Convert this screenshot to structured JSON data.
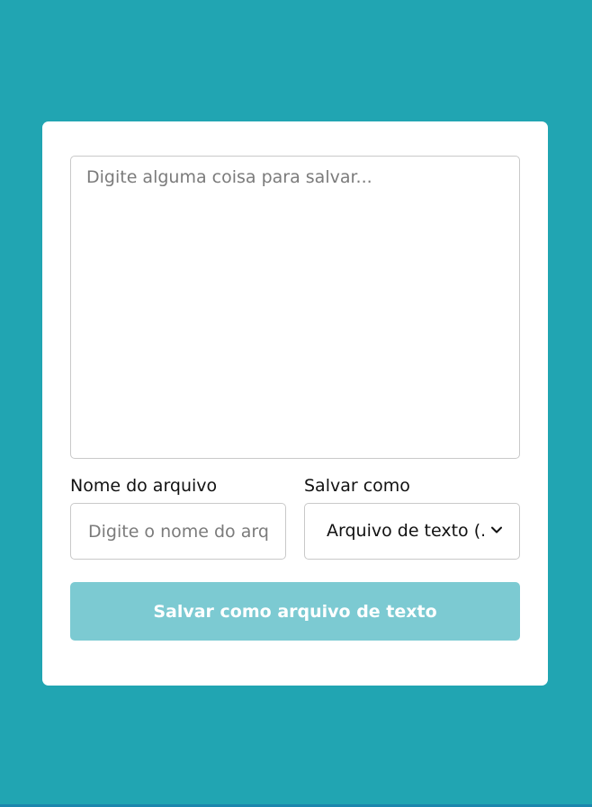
{
  "editor": {
    "placeholder": "Digite alguma coisa para salvar...",
    "value": ""
  },
  "filename": {
    "label": "Nome do arquivo",
    "placeholder": "Digite o nome do arquivo",
    "value": ""
  },
  "save_as": {
    "label": "Salvar como",
    "selected": "Arquivo de texto (.txt)"
  },
  "save_button": {
    "label": "Salvar como arquivo de texto"
  },
  "colors": {
    "page_background": "#21a5b2",
    "button_background": "#7ccad2",
    "button_text": "#ffffff"
  },
  "icons": {
    "select_arrow": "chevron-down-icon"
  }
}
